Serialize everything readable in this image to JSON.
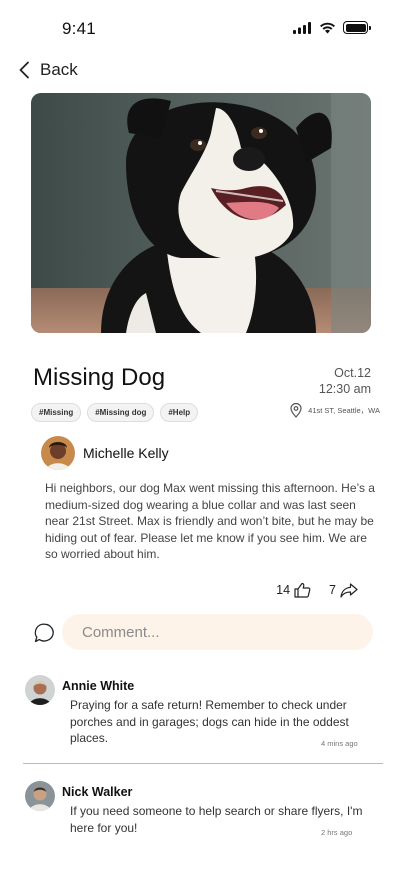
{
  "status_bar": {
    "time": "9:41"
  },
  "nav": {
    "back_label": "Back"
  },
  "post": {
    "title": "Missing Dog",
    "date": "Oct.12",
    "time": "12:30 am",
    "tags": [
      "#Missing",
      "#Missing dog",
      "#Help"
    ],
    "location": "41st ST, Seattle，WA",
    "author": "Michelle Kelly",
    "body": "Hi neighbors, our dog Max went missing this afternoon. He’s a medium-sized dog wearing a blue collar and was last seen near 21st Street. Max is friendly and won’t bite, but he may be hiding out of fear. Please let me know if you see him. We are so worried about him.",
    "likes": "14",
    "shares": "7"
  },
  "comment_box": {
    "placeholder": "Comment..."
  },
  "comments": [
    {
      "name": "Annie White",
      "text": "Praying for a safe return! Remember to check under porches and in garages; dogs can hide in the oddest places.",
      "time": "4 mins ago"
    },
    {
      "name": "Nick Walker",
      "text": "If you need someone to help search or share flyers, I'm here for you!",
      "time": "2 hrs ago"
    }
  ]
}
